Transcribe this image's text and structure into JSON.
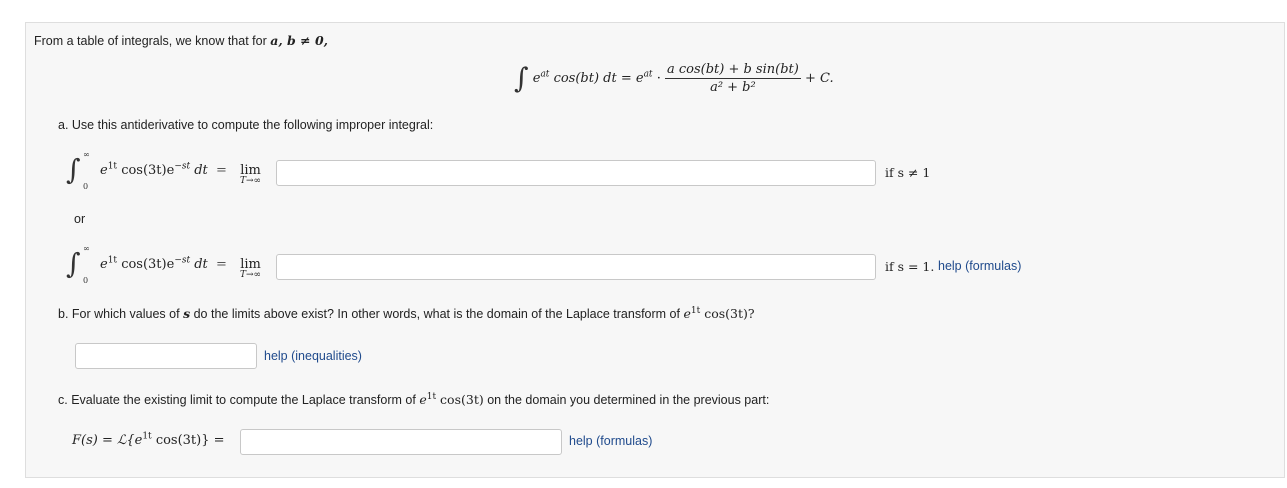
{
  "intro": {
    "text": "From a table of integrals, we know that for",
    "condition": "a, b ≠ 0,"
  },
  "formula": {
    "integral_lhs": "cos(bt) dt = e",
    "exp_at": "at",
    "dot": "·",
    "numerator": "a cos(bt) + b sin(bt)",
    "denominator": "a² + b²",
    "plus_c": "+ C."
  },
  "part_a": {
    "label": "a. Use this antiderivative to compute the following improper integral:",
    "integral_lower": "0",
    "integral_upper": "∞",
    "integrand_e": "e",
    "integrand_exp": "1t",
    "integrand_cos": "cos(3t)e",
    "integrand_exp2": "−st",
    "integrand_dt": "dt",
    "equals": "=",
    "lim_word": "lim",
    "lim_sub": "T→∞",
    "cond1": "if s ≠ 1",
    "or_text": "or",
    "cond2": "if s = 1.",
    "help_link": "help (formulas)",
    "input1_value": "",
    "input2_value": ""
  },
  "part_b": {
    "label_pre": "b. For which values of",
    "var": "s",
    "label_mid": "do the limits above exist? In other words, what is the domain of the Laplace transform of",
    "expr": "e",
    "expr_exp": "1t",
    "expr_tail": "cos(3t)?",
    "input_value": "",
    "help_link": "help (inequalities)"
  },
  "part_c": {
    "label_pre": "c. Evaluate the existing limit to compute the Laplace transform of",
    "expr": "e",
    "expr_exp": "1t",
    "expr_tail": "cos(3t)",
    "label_post": "on the domain you determined in the previous part:",
    "lhs": "F(s) = ℒ{e",
    "lhs_exp": "1t",
    "lhs_tail": "cos(3t)} =",
    "input_value": "",
    "help_link": "help (formulas)"
  }
}
